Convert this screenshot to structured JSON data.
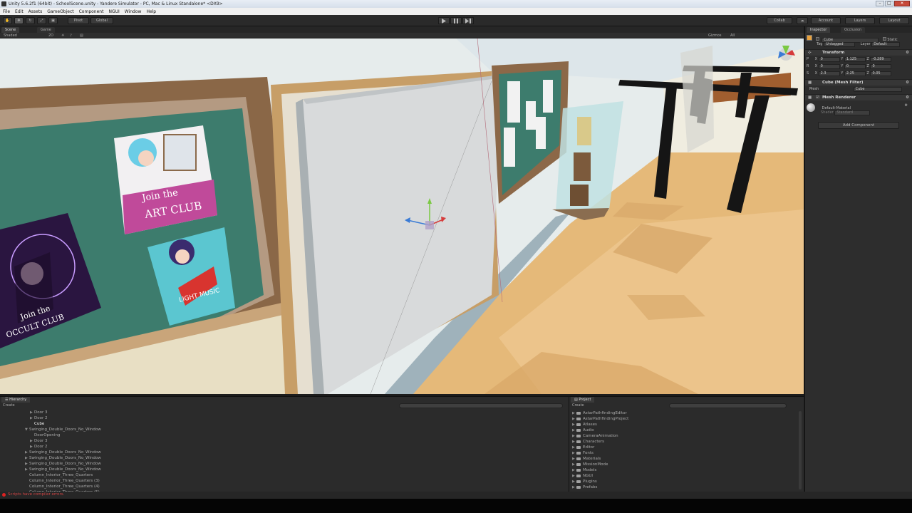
{
  "window": {
    "title": "Unity 5.6.2f1 (64bit) - SchoolScene.unity - Yandere Simulator - PC, Mac & Linux Standalone* <DX9>"
  },
  "menu": [
    "File",
    "Edit",
    "Assets",
    "GameObject",
    "Component",
    "NGUI",
    "Window",
    "Help"
  ],
  "toolbar": {
    "pivot": "Pivot",
    "global": "Global",
    "collab": "Collab",
    "account": "Account",
    "layers": "Layers",
    "layout": "Layout"
  },
  "scene": {
    "tabs": [
      "Scene",
      "Game"
    ],
    "shading": "Shaded",
    "mode_2d": "2D",
    "gizmos": "Gizmos",
    "search": "All"
  },
  "inspector": {
    "tabs": [
      "Inspector",
      "Occlusion"
    ],
    "object_name": "Cube",
    "static_label": "Static",
    "tag_label": "Tag",
    "tag_value": "Untagged",
    "layer_label": "Layer",
    "layer_value": "Default",
    "transform": {
      "title": "Transform",
      "position": {
        "label": "P",
        "x": "0",
        "y": "1.125",
        "z": "-0.289"
      },
      "rotation": {
        "label": "R",
        "x": "0",
        "y": "0",
        "z": "0"
      },
      "scale": {
        "label": "S",
        "x": "2.3",
        "y": "2.25",
        "z": "0.05"
      }
    },
    "mesh_filter": {
      "title": "Cube (Mesh Filter)",
      "mesh_label": "Mesh",
      "mesh_value": "Cube"
    },
    "mesh_renderer": {
      "title": "Mesh Renderer"
    },
    "material": {
      "name": "Default-Material",
      "shader_label": "Shader",
      "shader_value": "Standard"
    },
    "add_component": "Add Component"
  },
  "hierarchy": {
    "tab": "Hierarchy",
    "create": "Create",
    "search": "All",
    "items": [
      {
        "label": "Door 3",
        "indent": 2,
        "arrow": true
      },
      {
        "label": "Door 2",
        "indent": 2,
        "arrow": true
      },
      {
        "label": "Cube",
        "indent": 2,
        "arrow": false,
        "selected": true
      },
      {
        "label": "Swinging_Double_Doors_No_Window",
        "indent": 1,
        "arrow": true,
        "open": true
      },
      {
        "label": "DoorOpening",
        "indent": 2,
        "arrow": false
      },
      {
        "label": "Door 3",
        "indent": 2,
        "arrow": true
      },
      {
        "label": "Door 2",
        "indent": 2,
        "arrow": true
      },
      {
        "label": "Swinging_Double_Doors_No_Window",
        "indent": 1,
        "arrow": true
      },
      {
        "label": "Swinging_Double_Doors_No_Window",
        "indent": 1,
        "arrow": true
      },
      {
        "label": "Swinging_Double_Doors_No_Window",
        "indent": 1,
        "arrow": true
      },
      {
        "label": "Swinging_Double_Doors_No_Window",
        "indent": 1,
        "arrow": true
      },
      {
        "label": "Column_Interior_Three_Quarters",
        "indent": 1,
        "arrow": false
      },
      {
        "label": "Column_Interior_Three_Quarters (3)",
        "indent": 1,
        "arrow": false
      },
      {
        "label": "Column_Interior_Three_Quarters (4)",
        "indent": 1,
        "arrow": false
      },
      {
        "label": "Column_Interior_Three_Quarters (5)",
        "indent": 1,
        "arrow": false
      }
    ]
  },
  "project": {
    "tab": "Project",
    "create": "Create",
    "folders": [
      "AstarPathfindingEditor",
      "AstarPathfindingProject",
      "Atlases",
      "Audio",
      "CameraAnimation",
      "Characters",
      "Editor",
      "Fonts",
      "Materials",
      "MissionMode",
      "Models",
      "NGUI",
      "Plugins",
      "Prefabs"
    ]
  },
  "posters": {
    "art_line1": "Join the",
    "art_line2": "ART CLUB",
    "occult_line1": "Join the",
    "occult_line2": "OCCULT CLUB",
    "music_text": "LIGHT MUSIC"
  },
  "status": {
    "message": "Scripts have compiler errors."
  },
  "colors": {
    "accent": "#3a72b0",
    "error": "#d22222"
  }
}
